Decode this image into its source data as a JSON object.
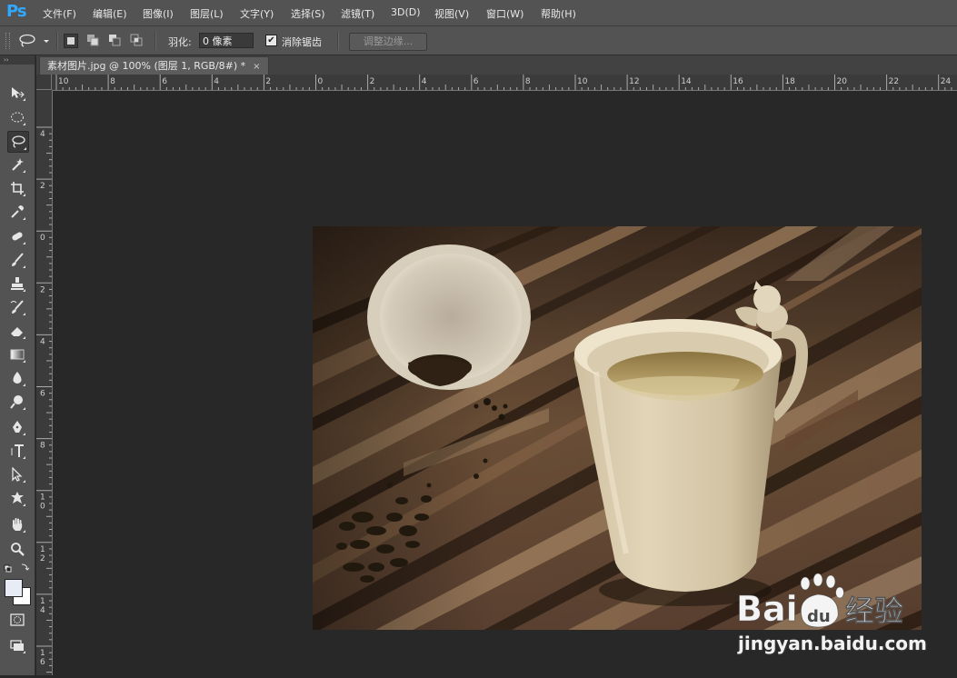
{
  "app": {
    "logo": "Ps"
  },
  "menu": {
    "items": [
      "文件(F)",
      "编辑(E)",
      "图像(I)",
      "图层(L)",
      "文字(Y)",
      "选择(S)",
      "滤镜(T)",
      "3D(D)",
      "视图(V)",
      "窗口(W)",
      "帮助(H)"
    ]
  },
  "options": {
    "feather_label": "羽化:",
    "feather_value": "0 像素",
    "antialias_label": "消除锯齿",
    "antialias_checked": true,
    "refine_edge_label": "调整边缘..."
  },
  "document": {
    "tab_title": "素材图片.jpg @ 100% (图层 1, RGB/8#) *",
    "close_glyph": "×"
  },
  "toolbox": {
    "header": "››",
    "tools": [
      "move",
      "elliptical-marquee",
      "lasso",
      "magic-wand",
      "crop",
      "eyedropper",
      "spot-healing",
      "brush",
      "clone-stamp",
      "history-brush",
      "eraser",
      "gradient",
      "blur",
      "dodge",
      "pen",
      "type",
      "path-selection",
      "custom-shape",
      "hand",
      "zoom"
    ],
    "active_tool": "lasso",
    "foreground_color": "#e8ecf5",
    "background_color": "#ffffff"
  },
  "rulers": {
    "horizontal_labels": [
      "10",
      "8",
      "6",
      "4",
      "2",
      "0",
      "2",
      "4",
      "6",
      "8",
      "10",
      "12",
      "14",
      "16",
      "18",
      "20",
      "22",
      "24"
    ],
    "vertical_labels": [
      "4",
      "2",
      "0",
      "2",
      "4",
      "6",
      "8",
      "1\n0",
      "1\n2",
      "1\n4",
      "1\n6"
    ]
  },
  "watermark": {
    "logo_text_left": "Bai",
    "logo_text_right": "du",
    "suffix": "经验",
    "url": "jingyan.baidu.com"
  }
}
